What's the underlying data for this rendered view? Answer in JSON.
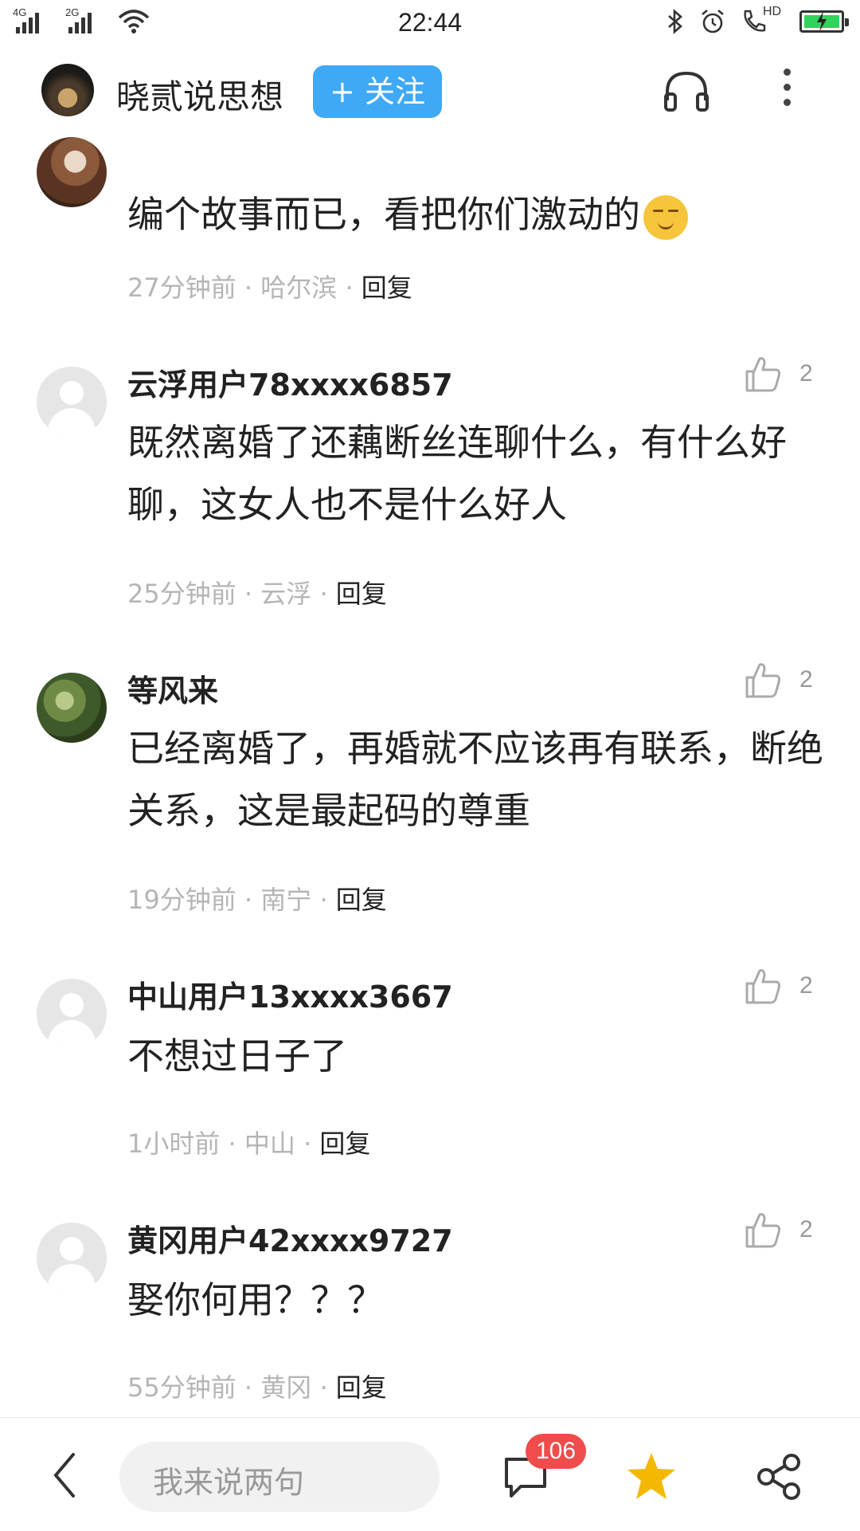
{
  "status_bar": {
    "net1": "4G",
    "net2": "2G",
    "time": "22:44",
    "hd": "HD",
    "icons": [
      "signal-icon",
      "wifi-icon",
      "bluetooth-icon",
      "alarm-icon",
      "hd-call-icon",
      "battery-charging-icon"
    ]
  },
  "header": {
    "title": "晓贰说思想",
    "follow_label": "+ 关注",
    "icons": [
      "headphone-icon",
      "more-vertical-icon"
    ]
  },
  "comments": [
    {
      "text": "编个故事而已，看把你们激动的",
      "time": "27分钟前",
      "location": "哈尔滨",
      "reply": "回复",
      "emoji": "smirk-emoji"
    },
    {
      "user": "云浮用户78xxxx6857",
      "likes": "2",
      "text": "既然离婚了还藕断丝连聊什么，有什么好聊，这女人也不是什么好人",
      "time": "25分钟前",
      "location": "云浮",
      "reply": "回复"
    },
    {
      "user": "等风来",
      "likes": "2",
      "text": "已经离婚了，再婚就不应该再有联系，断绝关系，这是最起码的尊重",
      "time": "19分钟前",
      "location": "南宁",
      "reply": "回复"
    },
    {
      "user": "中山用户13xxxx3667",
      "likes": "2",
      "text": "不想过日子了",
      "time": "1小时前",
      "location": "中山",
      "reply": "回复"
    },
    {
      "user": "黄冈用户42xxxx9727",
      "likes": "2",
      "text": "娶你何用？？？",
      "time": "55分钟前",
      "location": "黄冈",
      "reply": "回复"
    }
  ],
  "bottom_bar": {
    "input_placeholder": "我来说两句",
    "comment_count": "106",
    "icons": [
      "back-icon",
      "comment-icon",
      "star-icon",
      "share-icon"
    ],
    "star_color": "#f5b800"
  },
  "colors": {
    "follow_button": "#3fa9f5",
    "badge": "#f04c4c",
    "meta_text": "#b5b5b5"
  }
}
